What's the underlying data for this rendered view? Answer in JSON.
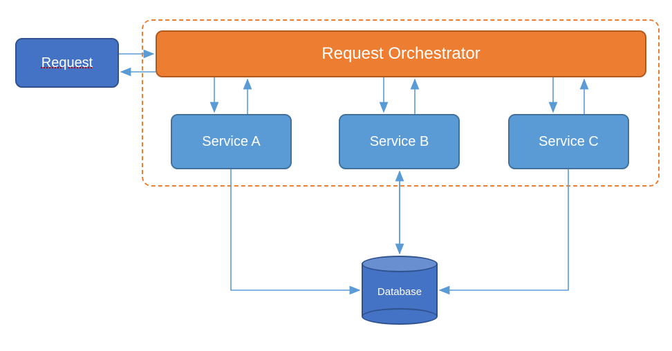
{
  "nodes": {
    "request": {
      "label": "Request"
    },
    "orchestrator": {
      "label": "Request Orchestrator"
    },
    "service_a": {
      "label": "Service A"
    },
    "service_b": {
      "label": "Service B"
    },
    "service_c": {
      "label": "Service C"
    },
    "database": {
      "label": "Database"
    }
  },
  "colors": {
    "arrow": "#5b9bd5",
    "request_fill": "#4472c4",
    "orchestrator_fill": "#ed7d31",
    "service_fill": "#5b9bd5",
    "group_border": "#ed7d31"
  }
}
